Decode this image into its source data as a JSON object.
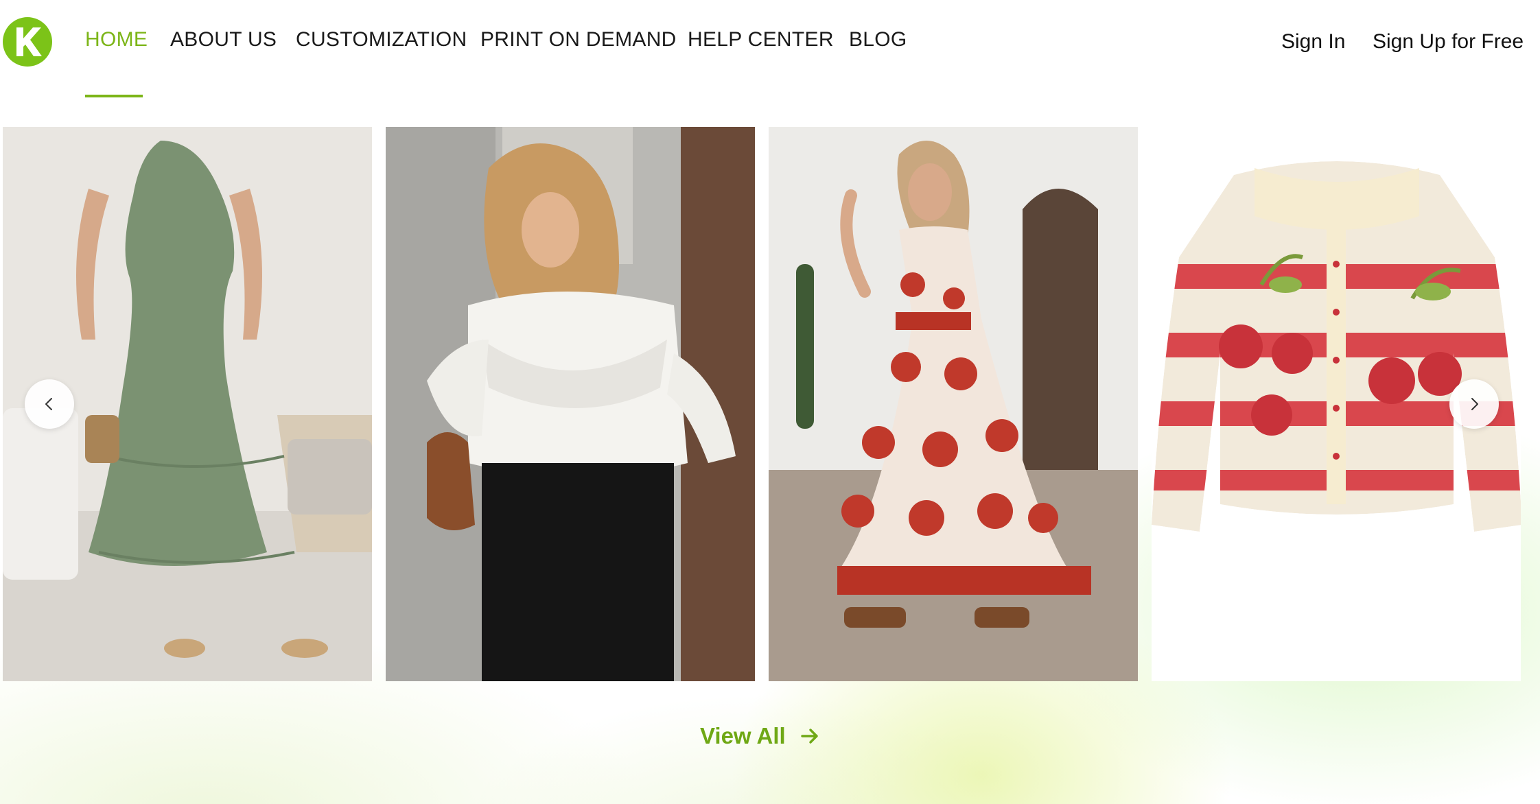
{
  "brand": {
    "logo_letter": "K",
    "accent_color": "#7cb518",
    "logo_color": "#7cc318"
  },
  "nav": {
    "items": [
      {
        "label": "HOME",
        "active": true
      },
      {
        "label": "ABOUT US",
        "active": false
      },
      {
        "label": "CUSTOMIZATION",
        "active": false
      },
      {
        "label": "PRINT ON DEMAND",
        "active": false
      },
      {
        "label": "HELP CENTER",
        "active": false
      },
      {
        "label": "BLOG",
        "active": false
      }
    ]
  },
  "auth": {
    "sign_in": "Sign In",
    "sign_up": "Sign Up for Free"
  },
  "carousel": {
    "products": [
      {
        "image": "green-halter-maxi-dress",
        "color": "#7b9272"
      },
      {
        "image": "white-ruffle-cold-shoulder-blouse",
        "color": "#f4f3ef"
      },
      {
        "image": "red-floral-print-maxi-dress",
        "color": "#c0392b"
      },
      {
        "image": "cherry-striped-knit-cardigan",
        "color": "#c8323a"
      }
    ],
    "prev_icon": "chevron-left-icon",
    "next_icon": "chevron-right-icon"
  },
  "view_all": {
    "label": "View All",
    "icon": "arrow-right-icon"
  }
}
